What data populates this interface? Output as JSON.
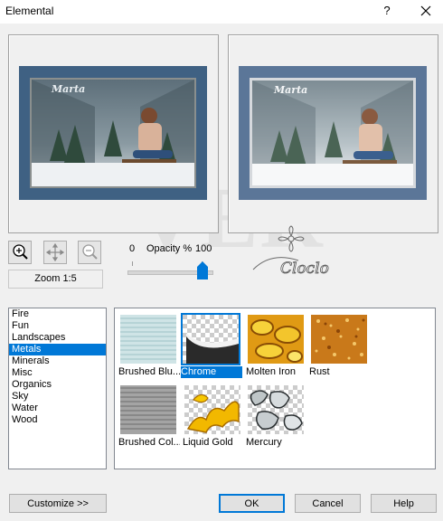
{
  "window": {
    "title": "Elemental",
    "help_glyph": "?",
    "close_icon": "close-icon"
  },
  "watermark_text": "VER",
  "preview": {
    "left_caption": "Marta",
    "right_caption": "Marta"
  },
  "tools": {
    "zoom_in_icon": "zoom-in-icon",
    "pan_icon": "move-icon",
    "zoom_out_icon": "zoom-out-icon",
    "zoom_label": "Zoom 1:5"
  },
  "opacity": {
    "min_label": "0",
    "title": "Opacity %",
    "max_label": "100",
    "value": 100
  },
  "logo_text": "Cloclo",
  "categories": [
    {
      "label": "Fire",
      "selected": false
    },
    {
      "label": "Fun",
      "selected": false
    },
    {
      "label": "Landscapes",
      "selected": false
    },
    {
      "label": "Metals",
      "selected": true
    },
    {
      "label": "Minerals",
      "selected": false
    },
    {
      "label": "Misc",
      "selected": false
    },
    {
      "label": "Organics",
      "selected": false
    },
    {
      "label": "Sky",
      "selected": false
    },
    {
      "label": "Water",
      "selected": false
    },
    {
      "label": "Wood",
      "selected": false
    }
  ],
  "presets": [
    {
      "label": "Brushed Blu...",
      "selected": false
    },
    {
      "label": "Chrome",
      "selected": true
    },
    {
      "label": "Molten Iron",
      "selected": false
    },
    {
      "label": "Rust",
      "selected": false
    },
    {
      "label": "Brushed Col...",
      "selected": false
    },
    {
      "label": "Liquid Gold",
      "selected": false
    },
    {
      "label": "Mercury",
      "selected": false
    }
  ],
  "buttons": {
    "customize": "Customize   >>",
    "ok": "OK",
    "cancel": "Cancel",
    "help": "Help"
  }
}
